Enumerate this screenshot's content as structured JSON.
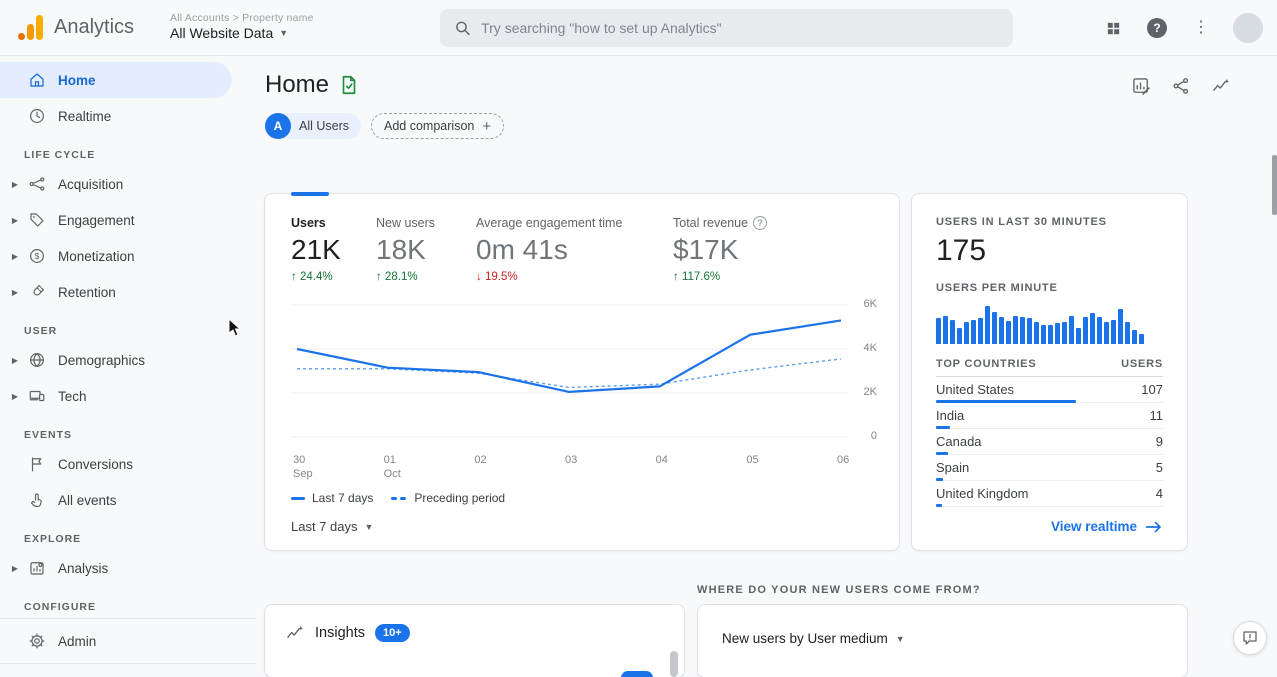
{
  "app": {
    "logo_label": "Analytics",
    "breadcrumb": "All Accounts > Property name",
    "property_selector": "All Website Data",
    "search_placeholder": "Try searching \"how to set up Analytics\"",
    "top_icons": [
      "apps-grid-icon",
      "help-icon",
      "more-vert-icon",
      "avatar"
    ]
  },
  "sidebar": {
    "primary": [
      {
        "label": "Home",
        "icon": "home-icon",
        "active": true
      },
      {
        "label": "Realtime",
        "icon": "clock-icon",
        "active": false
      }
    ],
    "groups": [
      {
        "title": "LIFE CYCLE",
        "items": [
          {
            "label": "Acquisition",
            "icon": "acquisition-icon",
            "expandable": true
          },
          {
            "label": "Engagement",
            "icon": "engagement-tag-icon",
            "expandable": true
          },
          {
            "label": "Monetization",
            "icon": "monetization-dollar-icon",
            "expandable": true
          },
          {
            "label": "Retention",
            "icon": "retention-magnet-icon",
            "expandable": true
          }
        ]
      },
      {
        "title": "USER",
        "items": [
          {
            "label": "Demographics",
            "icon": "globe-icon",
            "expandable": true
          },
          {
            "label": "Tech",
            "icon": "devices-icon",
            "expandable": true
          }
        ]
      },
      {
        "title": "EVENTS",
        "items": [
          {
            "label": "Conversions",
            "icon": "flag-icon",
            "expandable": false
          },
          {
            "label": "All events",
            "icon": "touch-icon",
            "expandable": false
          }
        ]
      },
      {
        "title": "EXPLORE",
        "items": [
          {
            "label": "Analysis",
            "icon": "analysis-icon",
            "expandable": true
          }
        ]
      },
      {
        "title": "CONFIGURE",
        "items": [
          {
            "label": "Admin",
            "icon": "gear-icon",
            "expandable": false
          }
        ]
      }
    ]
  },
  "page": {
    "title": "Home",
    "comparison": {
      "avatar_letter": "A",
      "primary_label": "All Users",
      "add_label": "Add comparison"
    },
    "header_icons": [
      "customize-report-icon",
      "share-icon",
      "insights-spark-icon"
    ]
  },
  "overview": {
    "metrics": [
      {
        "label": "Users",
        "value": "21K",
        "arrow": "↑",
        "delta": "24.4%",
        "direction": "up"
      },
      {
        "label": "New users",
        "value": "18K",
        "arrow": "↑",
        "delta": "28.1%",
        "direction": "up"
      },
      {
        "label": "Average engagement time",
        "value": "0m 41s",
        "arrow": "↓",
        "delta": "19.5%",
        "direction": "down"
      },
      {
        "label": "Total revenue",
        "value": "$17K",
        "arrow": "↑",
        "delta": "117.6%",
        "direction": "up",
        "has_help": true
      }
    ],
    "footer_selector": "Last 7 days"
  },
  "realtime": {
    "title": "USERS IN LAST 30 MINUTES",
    "users_count": "175",
    "per_minute_label": "USERS PER MINUTE",
    "table_headers": [
      "TOP COUNTRIES",
      "USERS"
    ],
    "countries": [
      {
        "name": "United States",
        "users": 107
      },
      {
        "name": "India",
        "users": 11
      },
      {
        "name": "Canada",
        "users": 9
      },
      {
        "name": "Spain",
        "users": 5
      },
      {
        "name": "United Kingdom",
        "users": 4
      }
    ],
    "link_label": "View realtime"
  },
  "bottom": {
    "question": "WHERE DO YOUR NEW USERS COME FROM?",
    "insights": {
      "label": "Insights",
      "badge": "10+"
    },
    "medium_card": {
      "selector": "New users by User medium"
    }
  },
  "colors": {
    "accent": "#1a73e8",
    "positive": "#137333",
    "negative": "#c5221f",
    "active_bg": "#e8f0fe"
  },
  "chart_data": [
    {
      "id": "users-overview-line",
      "type": "line",
      "title": "Users over time (Last 7 days vs Preceding period)",
      "x_ticks": [
        {
          "label": "30",
          "sub": "Sep"
        },
        {
          "label": "01",
          "sub": "Oct"
        },
        {
          "label": "02",
          "sub": ""
        },
        {
          "label": "03",
          "sub": ""
        },
        {
          "label": "04",
          "sub": ""
        },
        {
          "label": "05",
          "sub": ""
        },
        {
          "label": "06",
          "sub": ""
        }
      ],
      "series": [
        {
          "name": "Last 7 days",
          "style": "solid",
          "values": [
            4000,
            3150,
            2950,
            2050,
            2300,
            4650,
            5300
          ]
        },
        {
          "name": "Preceding period",
          "style": "dashed",
          "values": [
            3100,
            3100,
            2900,
            2250,
            2400,
            3050,
            3550
          ]
        }
      ],
      "ylim": [
        0,
        6000
      ],
      "yticks": [
        {
          "v": 0,
          "label": "0"
        },
        {
          "v": 2000,
          "label": "2K"
        },
        {
          "v": 4000,
          "label": "4K"
        },
        {
          "v": 6000,
          "label": "6K"
        }
      ],
      "grid": true,
      "legend_position": "bottom-left"
    },
    {
      "id": "users-per-minute-bars",
      "type": "bar",
      "title": "Users per minute (last 30 minutes)",
      "values": [
        26,
        28,
        24,
        16,
        22,
        24,
        26,
        38,
        32,
        27,
        23,
        28,
        27,
        26,
        22,
        19,
        19,
        21,
        22,
        28,
        16,
        27,
        31,
        27,
        22,
        24,
        35,
        22,
        14,
        10
      ]
    }
  ]
}
